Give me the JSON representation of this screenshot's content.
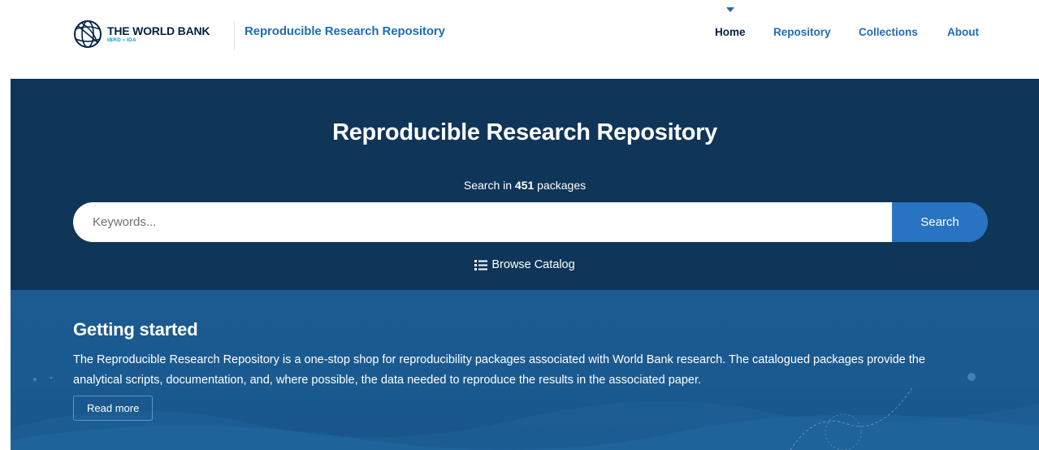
{
  "header": {
    "logo_name": "THE WORLD BANK",
    "logo_sub": "IBRD • IDA",
    "site_title": "Reproducible Research Repository"
  },
  "nav": {
    "items": [
      {
        "label": "Home",
        "active": true
      },
      {
        "label": "Repository"
      },
      {
        "label": "Collections"
      },
      {
        "label": "About"
      }
    ]
  },
  "hero": {
    "title": "Reproducible Research Repository",
    "count_prefix": "Search in ",
    "count_value": "451",
    "count_suffix": " packages",
    "search_placeholder": "Keywords...",
    "search_button": "Search",
    "browse_label": "Browse Catalog"
  },
  "getting_started": {
    "title": "Getting started",
    "text": "The Reproducible Research Repository is a one-stop shop for reproducibility packages associated with World Bank research. The catalogued packages provide the analytical scripts, documentation, and, where possible, the data needed to reproduce the results in the associated paper.",
    "read_more": "Read more"
  },
  "colors": {
    "brand_navy": "#002244",
    "link_blue": "#1f6cb8",
    "hero_bg": "#0f3559",
    "search_button": "#2873c2",
    "section_bg": "#1c5b91"
  }
}
